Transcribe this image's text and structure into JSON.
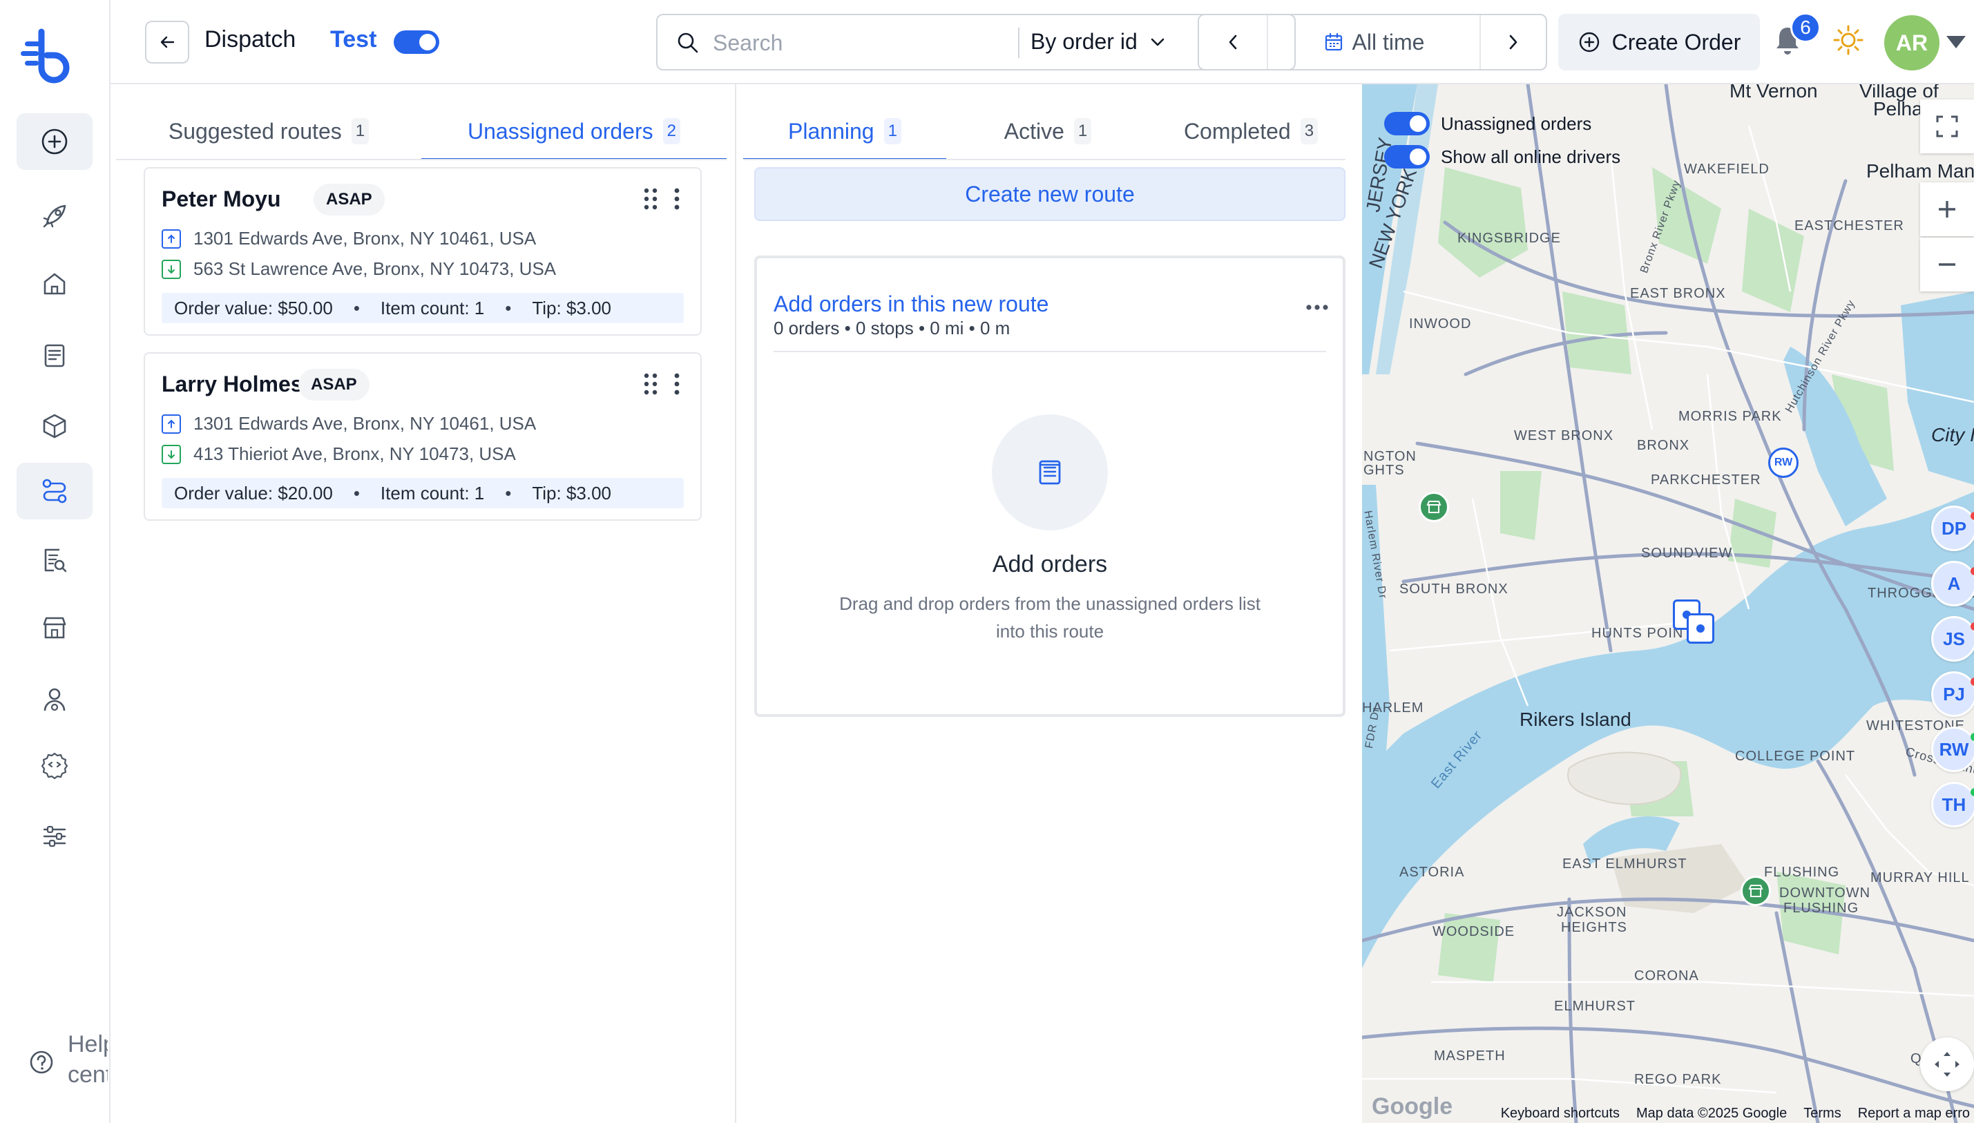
{
  "header": {
    "title": "Dispatch",
    "test_label": "Test",
    "search_placeholder": "Search",
    "search_filter": "By order id",
    "date_range": "All time",
    "create_order": "Create Order",
    "notification_count": "6",
    "avatar_initials": "AR"
  },
  "sidebar": {
    "help_label": "Help center",
    "items": [
      {
        "icon": "add-circle-icon"
      },
      {
        "icon": "rocket-icon"
      },
      {
        "icon": "home-icon"
      },
      {
        "icon": "orders-list-icon"
      },
      {
        "icon": "package-icon"
      },
      {
        "icon": "route-icon",
        "active": true
      },
      {
        "icon": "report-search-icon"
      },
      {
        "icon": "store-icon"
      },
      {
        "icon": "driver-icon"
      },
      {
        "icon": "developer-settings-icon"
      },
      {
        "icon": "filters-icon"
      }
    ]
  },
  "left_panel": {
    "tabs": [
      {
        "label": "Suggested routes",
        "count": "1"
      },
      {
        "label": "Unassigned orders",
        "count": "2",
        "active": true
      }
    ],
    "orders": [
      {
        "name": "Peter Moyu",
        "badge": "ASAP",
        "pickup": "1301 Edwards Ave, Bronx, NY 10461, USA",
        "dropoff": "563 St Lawrence Ave, Bronx, NY 10473, USA",
        "order_value": "Order value: $50.00",
        "item_count": "Item count: 1",
        "tip": "Tip: $3.00"
      },
      {
        "name": "Larry Holmes",
        "badge": "ASAP",
        "pickup": "1301 Edwards Ave, Bronx, NY 10461, USA",
        "dropoff": "413 Thieriot Ave, Bronx, NY 10473, USA",
        "order_value": "Order value: $20.00",
        "item_count": "Item count: 1",
        "tip": "Tip: $3.00"
      }
    ]
  },
  "middle_panel": {
    "tabs": [
      {
        "label": "Planning",
        "count": "1",
        "active": true
      },
      {
        "label": "Active",
        "count": "1"
      },
      {
        "label": "Completed",
        "count": "3"
      }
    ],
    "create_route": "Create new route",
    "route": {
      "title": "Add orders in this new route",
      "stats": "0 orders • 0 stops • 0 mi • 0 m",
      "empty_title": "Add orders",
      "empty_desc_line1": "Drag and drop orders from the unassigned orders list",
      "empty_desc_line2": "into this route"
    }
  },
  "map": {
    "toggles": [
      {
        "label": "Unassigned orders",
        "on": true
      },
      {
        "label": "Show all online drivers",
        "on": true
      }
    ],
    "labels": {
      "mt_vernon": "Mt Vernon",
      "village_of_pelham": "Village of",
      "pelham": "Pelham",
      "pelham_manor": "Pelham Manor",
      "wakefield": "WAKEFIELD",
      "eastchester": "EASTCHESTER",
      "kingsbridge": "KINGSBRIDGE",
      "new_york": "NEW YORK",
      "jersey": "JERSEY",
      "east_bronx": "EAST BRONX",
      "inwood": "INWOOD",
      "morris_park": "MORRIS PARK",
      "west_bronx": "WEST BRONX",
      "bronx": "BRONX",
      "parkchester": "PARKCHESTER",
      "city_island": "City I",
      "soundview": "SOUNDVIEW",
      "south_bronx": "SOUTH BRONX",
      "throggs_neck": "THROGGS NEC",
      "hunts_point": "HUNTS POINT",
      "harlem": "HARLEM",
      "rikers_island": "Rikers Island",
      "whitestone": "WHITESTONE",
      "college_point": "COLLEGE POINT",
      "astoria": "ASTORIA",
      "east_elmhurst": "EAST ELMHURST",
      "flushing": "FLUSHING",
      "downtown_flushing_1": "DOWNTOWN",
      "downtown_flushing_2": "FLUSHING",
      "murray_hill": "MURRAY HILL",
      "jackson_heights_1": "JACKSON",
      "jackson_heights_2": "HEIGHTS",
      "woodside": "WOODSIDE",
      "corona": "CORONA",
      "elmhurst": "ELMHURST",
      "maspeth": "MASPETH",
      "rego_park": "REGO PARK",
      "east_river": "East River",
      "harlem_river": "Harlem River Dr",
      "bronx_river_pkwy": "Bronx River Pkwy",
      "hutchinson_pkwy": "Hutchinson River Pkwy",
      "cross_island": "Cross Island",
      "fdr": "FDR Dr",
      "ngton": "NGTON",
      "ghts": "GHTS",
      "q": "Q"
    },
    "drivers": [
      {
        "initials": "DP",
        "status_color": "#ef4444"
      },
      {
        "initials": "A",
        "status_color": "#ef4444"
      },
      {
        "initials": "JS",
        "status_color": "#ef4444"
      },
      {
        "initials": "PJ",
        "status_color": "#ef4444"
      },
      {
        "initials": "RW",
        "status_color": "#22c55e"
      },
      {
        "initials": "TH",
        "status_color": "#22c55e"
      }
    ],
    "rw_pin": "RW",
    "google": "Google",
    "footer": {
      "shortcuts": "Keyboard shortcuts",
      "data": "Map data ©2025 Google",
      "terms": "Terms",
      "report": "Report a map erro"
    }
  },
  "colors": {
    "accent": "#2563eb",
    "avatar": "#8dc86b",
    "water": "#a8d5ec",
    "park": "#c7e6c4"
  }
}
